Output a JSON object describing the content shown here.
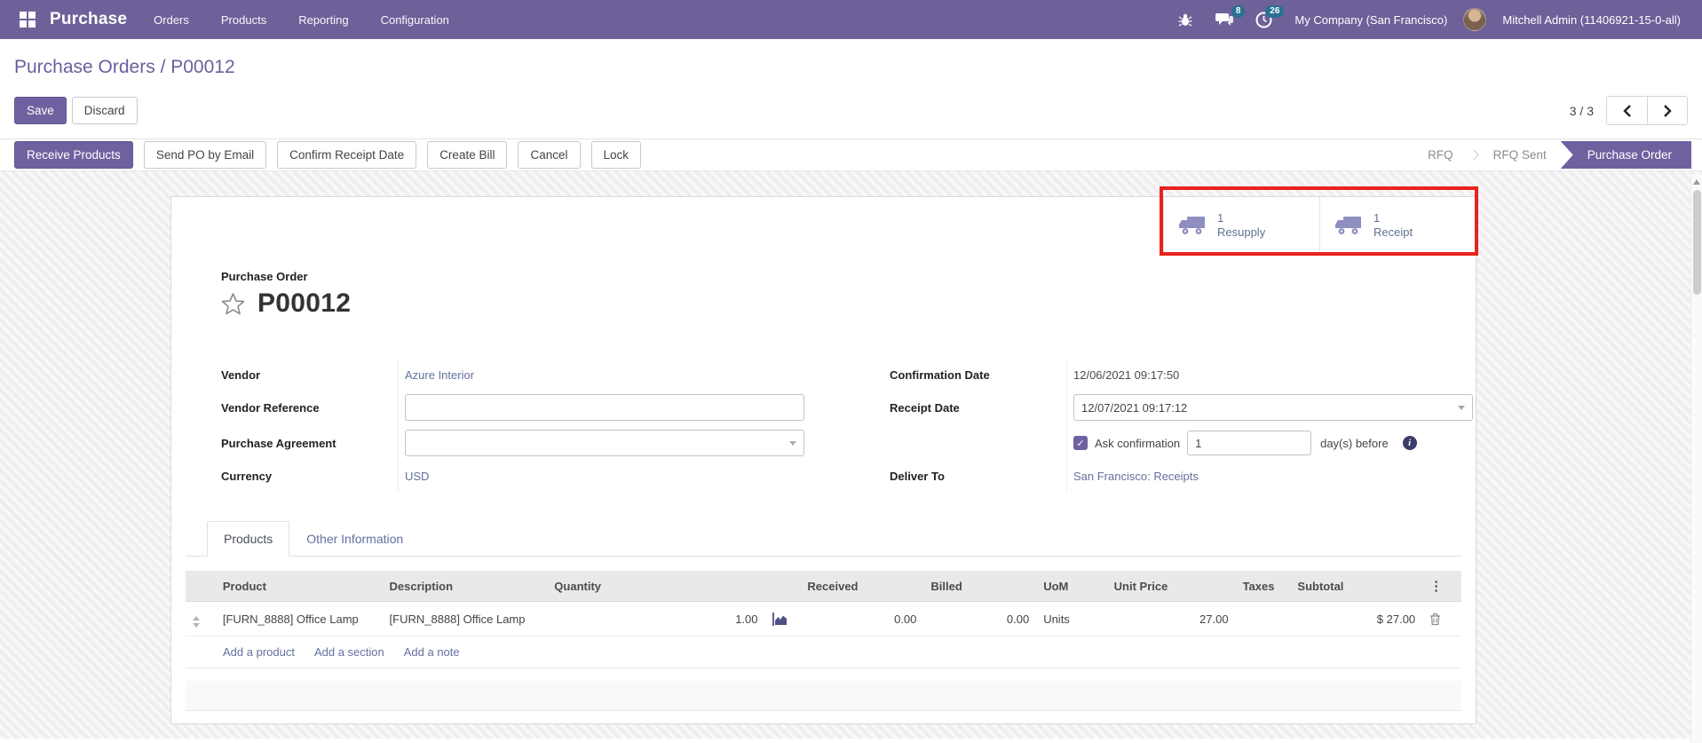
{
  "colors": {
    "navbar_purple": "#6e6199",
    "primary_purple": "#6f61a0",
    "breadcrumb_purple": "#6b5f9e",
    "link_slate": "#63719f",
    "badge_teal": "#2a7090",
    "annotation_red": "#e7231d"
  },
  "navbar": {
    "app_name": "Purchase",
    "menus": [
      "Orders",
      "Products",
      "Reporting",
      "Configuration"
    ],
    "messages_badge": "8",
    "activities_badge": "26",
    "company": "My Company (San Francisco)",
    "user": "Mitchell Admin (11406921-15-0-all)"
  },
  "breadcrumb": {
    "parent": "Purchase Orders",
    "separator": " / ",
    "current": "P00012"
  },
  "control_panel": {
    "save_label": "Save",
    "discard_label": "Discard",
    "pager": "3 / 3"
  },
  "action_bar": {
    "buttons": {
      "receive": "Receive Products",
      "send_email": "Send PO by Email",
      "confirm_receipt": "Confirm Receipt Date",
      "create_bill": "Create Bill",
      "cancel": "Cancel",
      "lock": "Lock"
    },
    "statusbar": {
      "rfq": "RFQ",
      "rfq_sent": "RFQ Sent",
      "purchase_order": "Purchase Order"
    }
  },
  "smart_buttons": {
    "resupply": {
      "count": "1",
      "label": "Resupply"
    },
    "receipt": {
      "count": "1",
      "label": "Receipt"
    }
  },
  "sheet": {
    "doc_type_label": "Purchase Order",
    "doc_name": "P00012",
    "fields": {
      "vendor": {
        "label": "Vendor",
        "value": "Azure Interior"
      },
      "vendor_reference": {
        "label": "Vendor Reference",
        "value": ""
      },
      "purchase_agreement": {
        "label": "Purchase Agreement",
        "value": ""
      },
      "currency": {
        "label": "Currency",
        "value": "USD"
      },
      "confirmation_date": {
        "label": "Confirmation Date",
        "value": "12/06/2021 09:17:50"
      },
      "receipt_date": {
        "label": "Receipt Date",
        "value": "12/07/2021 09:17:12"
      },
      "ask_confirmation": {
        "label": "Ask confirmation",
        "days": "1",
        "suffix": "day(s) before"
      },
      "deliver_to": {
        "label": "Deliver To",
        "value": "San Francisco: Receipts"
      }
    },
    "tabs": {
      "products": "Products",
      "other_info": "Other Information"
    },
    "table": {
      "headers": {
        "product": "Product",
        "description": "Description",
        "quantity": "Quantity",
        "received": "Received",
        "billed": "Billed",
        "uom": "UoM",
        "unit_price": "Unit Price",
        "taxes": "Taxes",
        "subtotal": "Subtotal"
      },
      "row": {
        "product": "[FURN_8888] Office Lamp",
        "description": "[FURN_8888] Office Lamp",
        "quantity": "1.00",
        "received": "0.00",
        "billed": "0.00",
        "uom": "Units",
        "unit_price": "27.00",
        "taxes": "",
        "subtotal": "$ 27.00"
      },
      "links": {
        "add_product": "Add a product",
        "add_section": "Add a section",
        "add_note": "Add a note"
      }
    }
  }
}
